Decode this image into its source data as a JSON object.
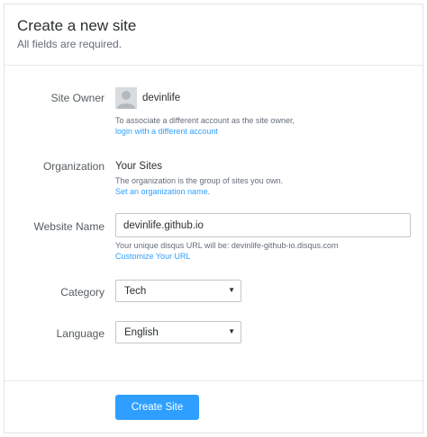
{
  "header": {
    "title": "Create a new site",
    "subtitle": "All fields are required."
  },
  "owner": {
    "label": "Site Owner",
    "username": "devinlife",
    "help_line1": "To associate a different account as the site owner,",
    "help_link": "login with a different account",
    "avatar_icon": "user-avatar-icon"
  },
  "organization": {
    "label": "Organization",
    "value": "Your Sites",
    "help_line1": "The organization is the group of sites you own.",
    "help_link": "Set an organization name",
    "help_link_suffix": "."
  },
  "website_name": {
    "label": "Website Name",
    "value": "devinlife.github.io",
    "help_line1": "Your unique disqus URL will be: devinlife-github-io.disqus.com",
    "help_link": "Customize Your URL"
  },
  "category": {
    "label": "Category",
    "selected": "Tech",
    "caret_icon": "chevron-down-icon"
  },
  "language": {
    "label": "Language",
    "selected": "English",
    "caret_icon": "chevron-down-icon"
  },
  "submit": {
    "label": "Create Site"
  },
  "colors": {
    "accent": "#2e9fff",
    "border": "#dfe3e6",
    "text": "#2a2e2e",
    "muted": "#656c7a"
  }
}
